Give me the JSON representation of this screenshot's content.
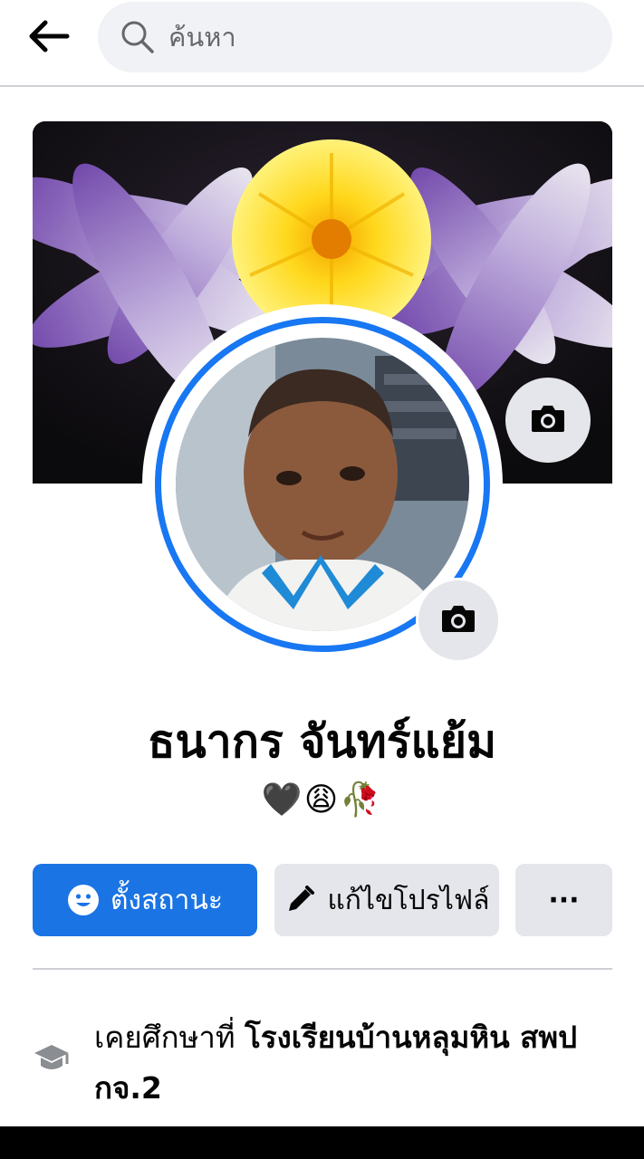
{
  "search": {
    "placeholder": "ค้นหา"
  },
  "profile": {
    "name": "ธนากร จันทร์แย้ม",
    "bio": "🖤😩🥀"
  },
  "actions": {
    "status_label": "ตั้งสถานะ",
    "edit_label": "แก้ไขโปรไฟล์",
    "more_label": "···"
  },
  "intro": {
    "education_prefix": "เคยศึกษาที่ ",
    "education_school": "โรงเรียนบ้านหลุมหิน สพป กจ.2"
  },
  "colors": {
    "accent": "#1b74e4",
    "avatar_ring": "#1877f2",
    "secondary_button": "#e4e6eb",
    "search_bg": "#f0f2f5"
  },
  "icons": {
    "back": "arrow-left-icon",
    "search": "search-icon",
    "cover_camera": "camera-icon",
    "avatar_camera": "camera-icon",
    "status": "smiley-icon",
    "edit": "pencil-icon",
    "education": "graduation-cap-icon"
  }
}
